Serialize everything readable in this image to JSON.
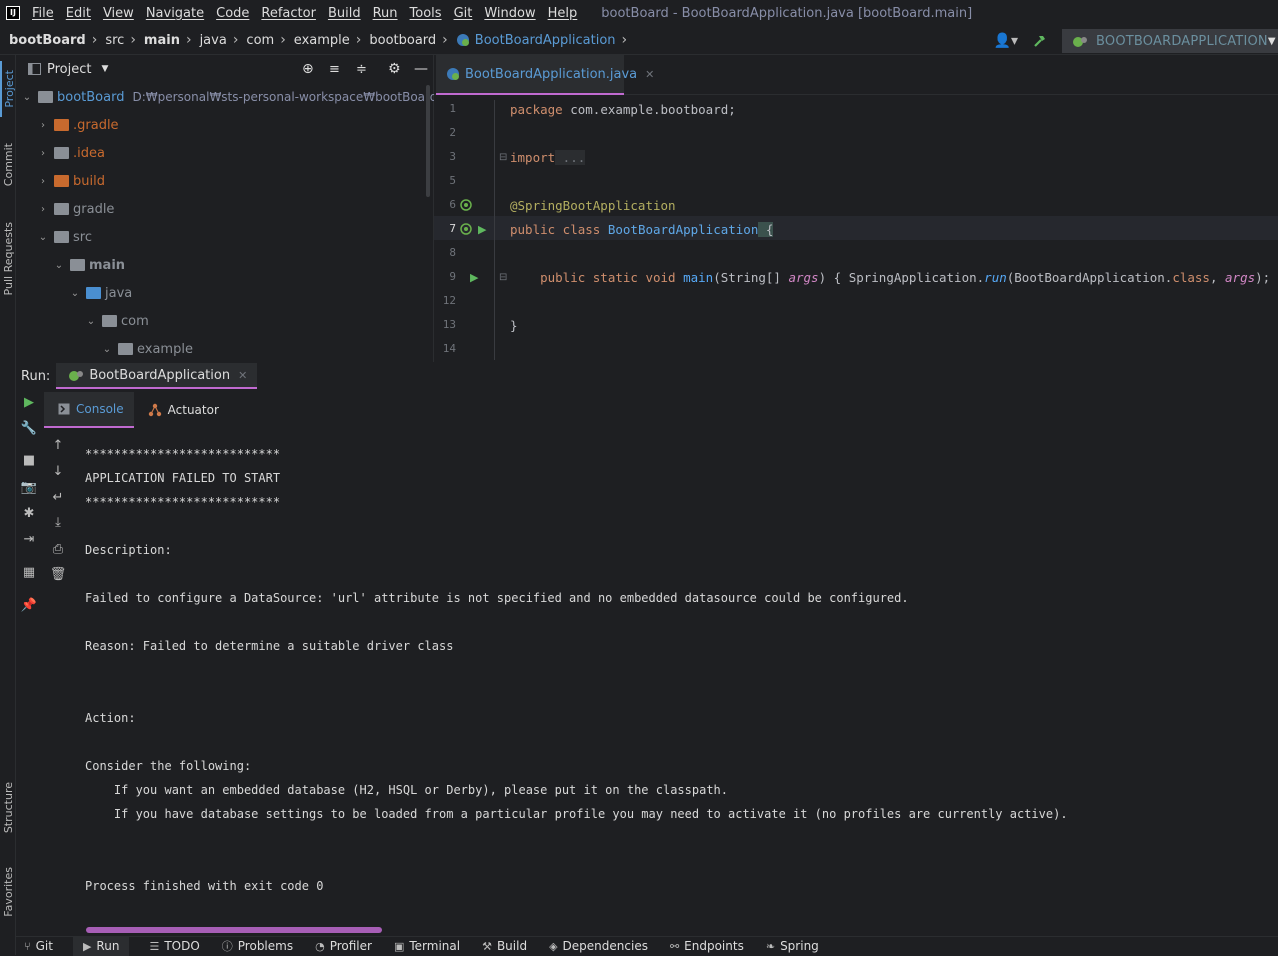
{
  "menubar": {
    "items": [
      "File",
      "Edit",
      "View",
      "Navigate",
      "Code",
      "Refactor",
      "Build",
      "Run",
      "Tools",
      "Git",
      "Window",
      "Help"
    ],
    "window_title": "bootBoard - BootBoardApplication.java [bootBoard.main]"
  },
  "breadcrumb": [
    "bootBoard",
    "src",
    "main",
    "java",
    "com",
    "example",
    "bootboard",
    "BootBoardApplication"
  ],
  "run_config": "BOOTBOARDAPPLICATION",
  "left_tool_tabs": [
    "Project",
    "Commit",
    "Pull Requests",
    "Structure",
    "Favorites"
  ],
  "project": {
    "title": "Project",
    "root_name": "bootBoard",
    "root_path": "D:₩personal₩sts-personal-workspace₩bootBoard",
    "items": [
      ".gradle",
      ".idea",
      "build",
      "gradle",
      "src",
      "main",
      "java",
      "com",
      "example"
    ]
  },
  "editor": {
    "tab_label": "BootBoardApplication.java",
    "line_numbers": [
      "1",
      "2",
      "3",
      "5",
      "6",
      "7",
      "8",
      "9",
      "12",
      "13",
      "14"
    ],
    "lines": {
      "l1_kw": "package",
      "l1_rest": " com.example.bootboard;",
      "l3_kw": "import",
      "l3_rest": " ...",
      "l6": "@SpringBootApplication",
      "l7_kw": "public class",
      "l7_cls": " BootBoardApplication",
      "l7_brace": " {",
      "l9_kw": "    public static void",
      "l9_fn": " main",
      "l9_a": "(String[] ",
      "l9_p1": "args",
      "l9_b": ") { SpringApplication.",
      "l9_run": "run",
      "l9_c": "(BootBoardApplication.",
      "l9_class": "class",
      "l9_d": ", ",
      "l9_p2": "args",
      "l9_e": "); }",
      "l13": "}"
    }
  },
  "run_panel": {
    "label": "Run:",
    "tab": "BootBoardApplication",
    "subtabs": [
      "Console",
      "Actuator"
    ]
  },
  "console": {
    "lines": [
      "***************************",
      "APPLICATION FAILED TO START",
      "***************************",
      "Description:",
      "Failed to configure a DataSource: 'url' attribute is not specified and no embedded datasource could be configured.",
      "Reason: Failed to determine a suitable driver class",
      "Action:",
      "Consider the following:",
      "    If you want an embedded database (H2, HSQL or Derby), please put it on the classpath.",
      "    If you have database settings to be loaded from a particular profile you may need to activate it (no profiles are currently active).",
      "Process finished with exit code 0"
    ]
  },
  "bottom_tabs": [
    "Git",
    "Run",
    "TODO",
    "Problems",
    "Profiler",
    "Terminal",
    "Build",
    "Dependencies",
    "Endpoints",
    "Spring"
  ],
  "colors": {
    "accent": "#c06ad0",
    "link": "#5a9bd5",
    "bg": "#1e1f22",
    "folder_excluded": "#c86a2e",
    "folder_normal": "#8a8f96",
    "folder_source": "#4a8fd1"
  }
}
